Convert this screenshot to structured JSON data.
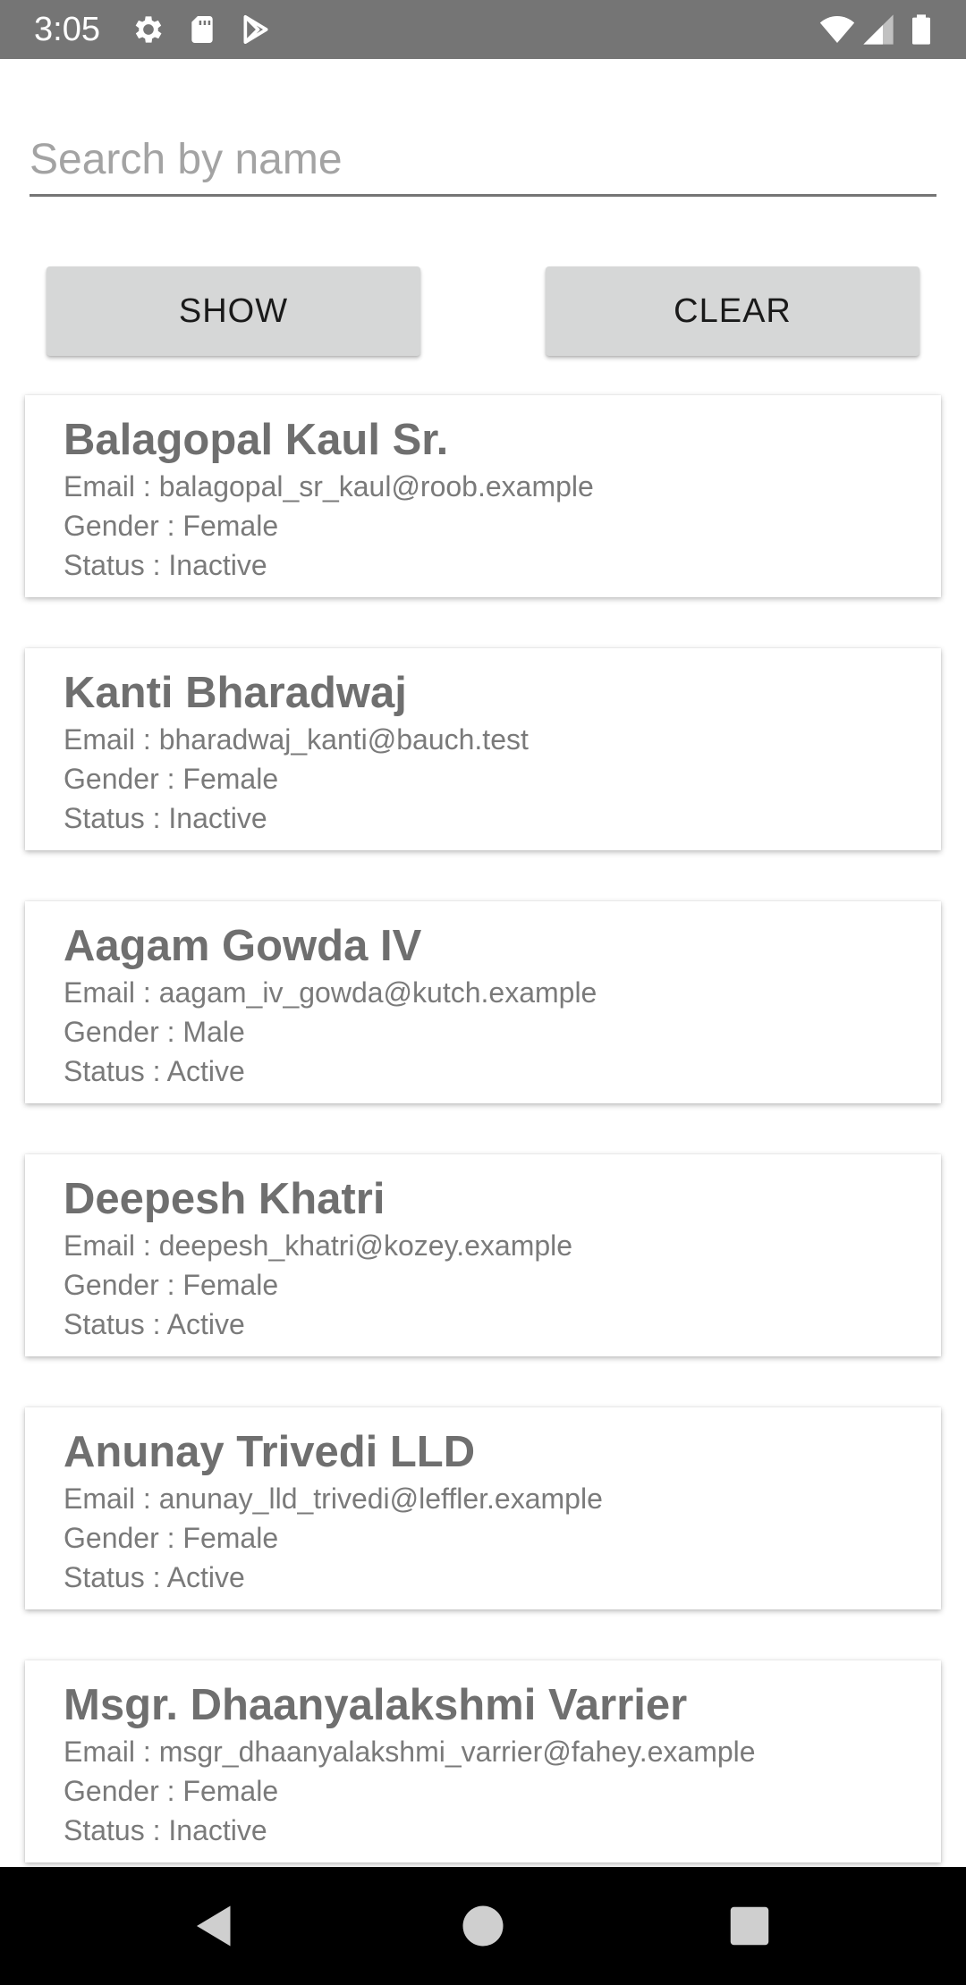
{
  "status_bar": {
    "time": "3:05",
    "icons": [
      "gear-icon",
      "sd-card-icon",
      "play-store-icon",
      "wifi-icon",
      "signal-icon",
      "battery-icon"
    ]
  },
  "search": {
    "placeholder": "Search by name",
    "value": ""
  },
  "buttons": {
    "show_label": "SHOW",
    "clear_label": "CLEAR"
  },
  "users": [
    {
      "name": "Balagopal Kaul Sr.",
      "email": "Email : balagopal_sr_kaul@roob.example",
      "gender": "Gender : Female",
      "status": "Status : Inactive"
    },
    {
      "name": "Kanti Bharadwaj",
      "email": "Email : bharadwaj_kanti@bauch.test",
      "gender": "Gender : Female",
      "status": "Status : Inactive"
    },
    {
      "name": "Aagam Gowda IV",
      "email": "Email : aagam_iv_gowda@kutch.example",
      "gender": "Gender : Male",
      "status": "Status : Active"
    },
    {
      "name": "Deepesh Khatri",
      "email": "Email : deepesh_khatri@kozey.example",
      "gender": "Gender : Female",
      "status": "Status : Active"
    },
    {
      "name": "Anunay Trivedi LLD",
      "email": "Email : anunay_lld_trivedi@leffler.example",
      "gender": "Gender : Female",
      "status": "Status : Active"
    },
    {
      "name": "Msgr. Dhaanyalakshmi Varrier",
      "email": "Email : msgr_dhaanyalakshmi_varrier@fahey.example",
      "gender": "Gender : Female",
      "status": "Status : Inactive"
    }
  ],
  "nav_bar": {
    "icons": [
      "back-icon",
      "home-icon",
      "recents-icon"
    ]
  },
  "colors": {
    "status_bar": "#757575",
    "button_bg": "#d6d7d7",
    "name_text": "#6f6f6f",
    "detail_text": "#7a7a7a",
    "nav_bar": "#000000"
  }
}
